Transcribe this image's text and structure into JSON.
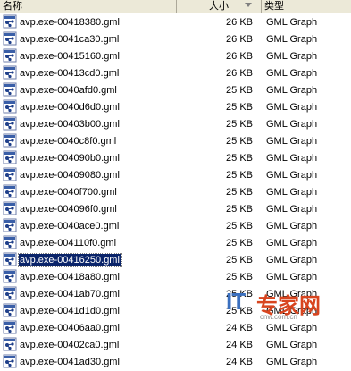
{
  "columns": {
    "name": "名称",
    "size": "大小",
    "type": "类型"
  },
  "files": [
    {
      "name": "avp.exe-00418380.gml",
      "size": "26 KB",
      "type": "GML Graph",
      "selected": false
    },
    {
      "name": "avp.exe-0041ca30.gml",
      "size": "26 KB",
      "type": "GML Graph",
      "selected": false
    },
    {
      "name": "avp.exe-00415160.gml",
      "size": "26 KB",
      "type": "GML Graph",
      "selected": false
    },
    {
      "name": "avp.exe-00413cd0.gml",
      "size": "26 KB",
      "type": "GML Graph",
      "selected": false
    },
    {
      "name": "avp.exe-0040afd0.gml",
      "size": "25 KB",
      "type": "GML Graph",
      "selected": false
    },
    {
      "name": "avp.exe-0040d6d0.gml",
      "size": "25 KB",
      "type": "GML Graph",
      "selected": false
    },
    {
      "name": "avp.exe-00403b00.gml",
      "size": "25 KB",
      "type": "GML Graph",
      "selected": false
    },
    {
      "name": "avp.exe-0040c8f0.gml",
      "size": "25 KB",
      "type": "GML Graph",
      "selected": false
    },
    {
      "name": "avp.exe-004090b0.gml",
      "size": "25 KB",
      "type": "GML Graph",
      "selected": false
    },
    {
      "name": "avp.exe-00409080.gml",
      "size": "25 KB",
      "type": "GML Graph",
      "selected": false
    },
    {
      "name": "avp.exe-0040f700.gml",
      "size": "25 KB",
      "type": "GML Graph",
      "selected": false
    },
    {
      "name": "avp.exe-004096f0.gml",
      "size": "25 KB",
      "type": "GML Graph",
      "selected": false
    },
    {
      "name": "avp.exe-0040ace0.gml",
      "size": "25 KB",
      "type": "GML Graph",
      "selected": false
    },
    {
      "name": "avp.exe-004110f0.gml",
      "size": "25 KB",
      "type": "GML Graph",
      "selected": false
    },
    {
      "name": "avp.exe-00416250.gml",
      "size": "25 KB",
      "type": "GML Graph",
      "selected": true
    },
    {
      "name": "avp.exe-00418a80.gml",
      "size": "25 KB",
      "type": "GML Graph",
      "selected": false
    },
    {
      "name": "avp.exe-0041ab70.gml",
      "size": "25 KB",
      "type": "GML Graph",
      "selected": false
    },
    {
      "name": "avp.exe-0041d1d0.gml",
      "size": "25 KB",
      "type": "GML Graph",
      "selected": false
    },
    {
      "name": "avp.exe-00406aa0.gml",
      "size": "24 KB",
      "type": "GML Graph",
      "selected": false
    },
    {
      "name": "avp.exe-00402ca0.gml",
      "size": "24 KB",
      "type": "GML Graph",
      "selected": false
    },
    {
      "name": "avp.exe-0041ad30.gml",
      "size": "24 KB",
      "type": "GML Graph",
      "selected": false
    }
  ],
  "file_icon": "gml-file-icon",
  "watermark": {
    "logo": "IT专家网",
    "url": "cnw.com.cn"
  },
  "colors": {
    "selection": "#0a246a",
    "header_bg": "#ece9d8"
  }
}
